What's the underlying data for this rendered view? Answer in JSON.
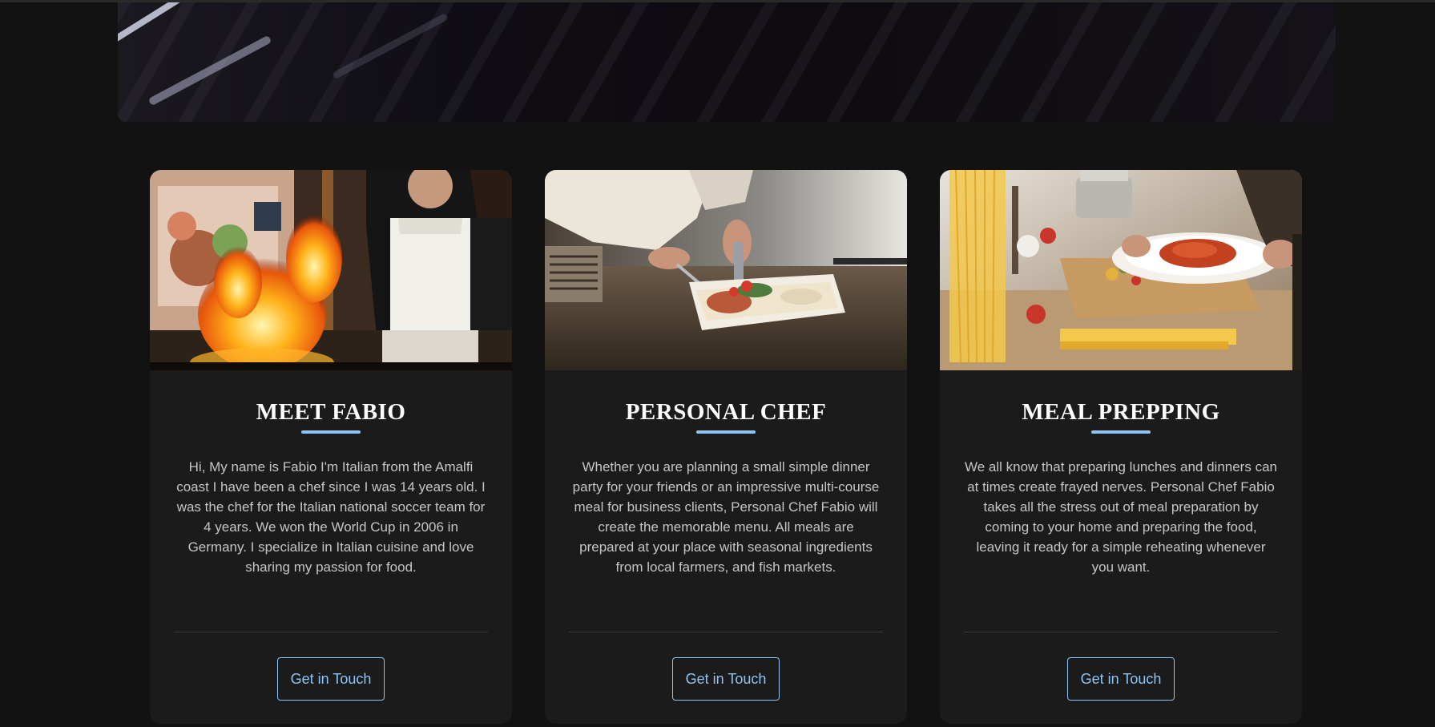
{
  "hero": {
    "image": "dark-grill-photo"
  },
  "cards": [
    {
      "title": "MEET FABIO",
      "image": "chef-flambe-photo",
      "text": "Hi, My name is Fabio I'm Italian from the Amalfi coast I have been a chef since I was 14 years old. I was the chef for the Italian national soccer team for 4 years. We won the World Cup in 2006 in Germany. I specialize in Italian cuisine and love sharing my passion for food.",
      "button": "Get in Touch"
    },
    {
      "title": "PERSONAL CHEF",
      "image": "chef-plating-photo",
      "text": "Whether you are planning a small simple dinner party for your friends or an impressive multi-course meal for business clients, Personal Chef Fabio will create the memorable menu. All meals are prepared at your place with seasonal ingredients from local farmers, and fish markets.",
      "button": "Get in Touch"
    },
    {
      "title": "MEAL PREPPING",
      "image": "pasta-preparation-photo",
      "text": "We all know that preparing lunches and dinners can at times create frayed nerves. Personal Chef Fabio takes all the stress out of meal preparation by coming to your home and preparing the food, leaving it ready for a simple reheating whenever you want.",
      "button": "Get in Touch"
    }
  ],
  "colors": {
    "background": "#121212",
    "card": "#1b1b1c",
    "accent": "#8ec3f2",
    "title": "#ffffff",
    "body_text": "#c5c5c5"
  }
}
